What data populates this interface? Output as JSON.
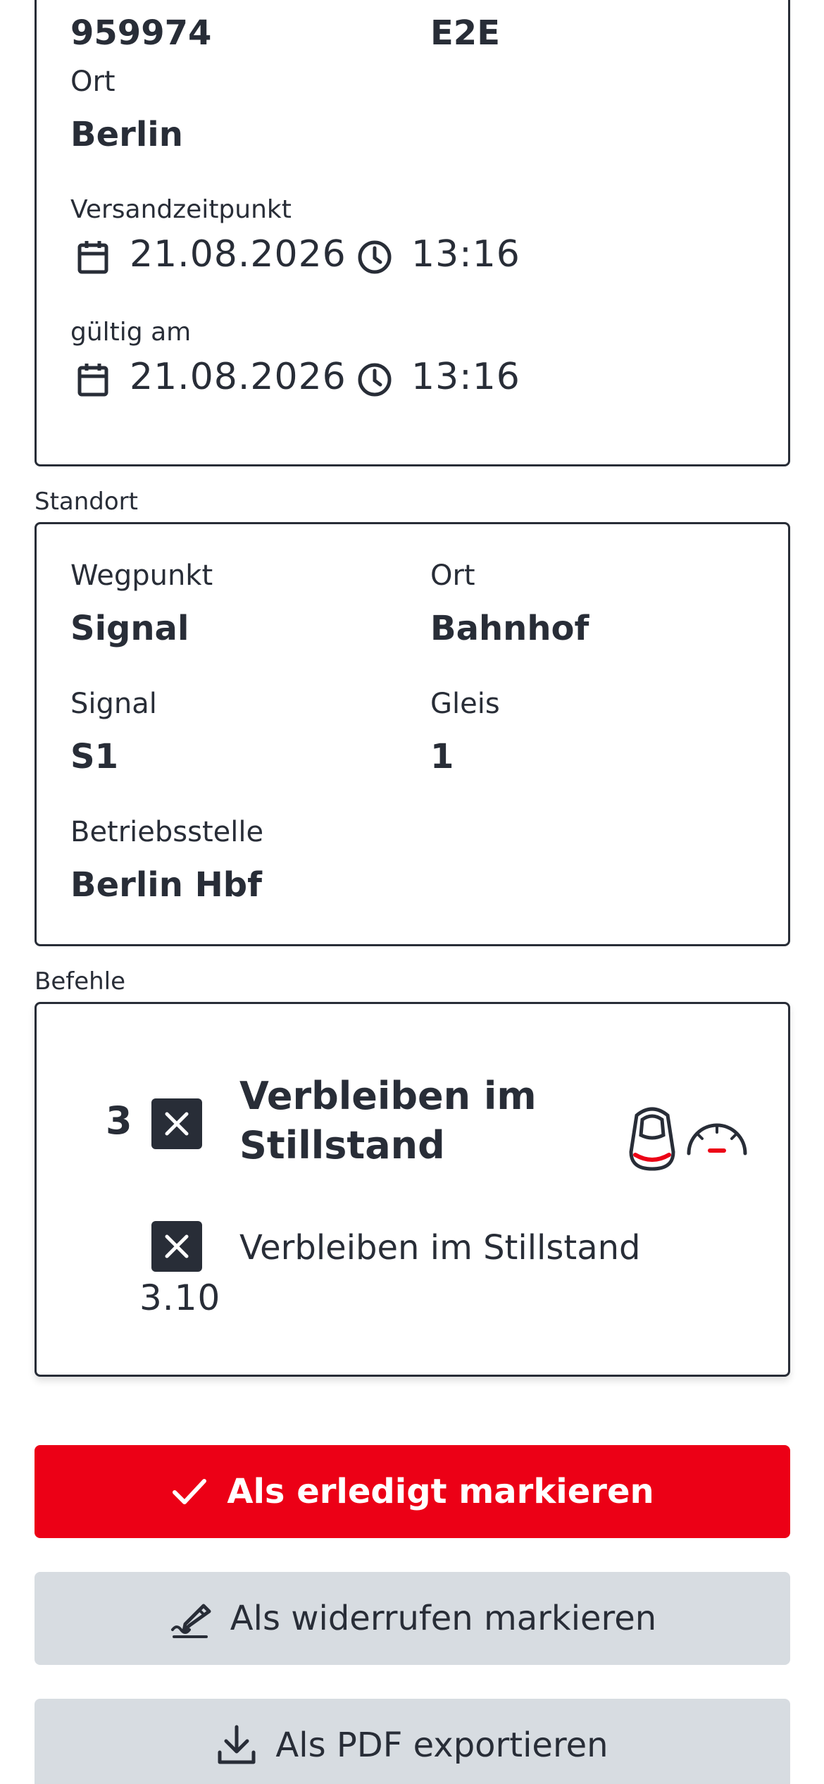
{
  "header_card": {
    "id_value": "959974",
    "type_value": "E2E",
    "ort_label": "Ort",
    "ort_value": "Berlin",
    "versand_label": "Versandzeitpunkt",
    "versand_date": "21.08.2026",
    "versand_time": "13:16",
    "gueltig_label": "gültig am",
    "gueltig_date": "21.08.2026",
    "gueltig_time": "13:16"
  },
  "standort": {
    "section_label": "Standort",
    "wegpunkt_label": "Wegpunkt",
    "wegpunkt_value": "Signal",
    "ort_label": "Ort",
    "ort_value": "Bahnhof",
    "signal_label": "Signal",
    "signal_value": "S1",
    "gleis_label": "Gleis",
    "gleis_value": "1",
    "betriebsstelle_label": "Betriebsstelle",
    "betriebsstelle_value": "Berlin Hbf"
  },
  "befehle": {
    "section_label": "Befehle",
    "main_number": "3",
    "main_title": "Verbleiben im Stillstand",
    "sub_number": "3.10",
    "sub_text": "Verbleiben im Stillstand"
  },
  "actions": {
    "done_label": "Als erledigt markieren",
    "revoke_label": "Als widerrufen markieren",
    "pdf_label": "Als PDF exportieren"
  },
  "colors": {
    "accent": "#ec0016",
    "text": "#282d37",
    "secondary_button": "#d7dce1"
  },
  "icons": [
    "calendar-icon",
    "clock-icon",
    "close-icon",
    "train-front-icon",
    "speedometer-icon",
    "check-icon",
    "edit-icon",
    "download-icon"
  ]
}
